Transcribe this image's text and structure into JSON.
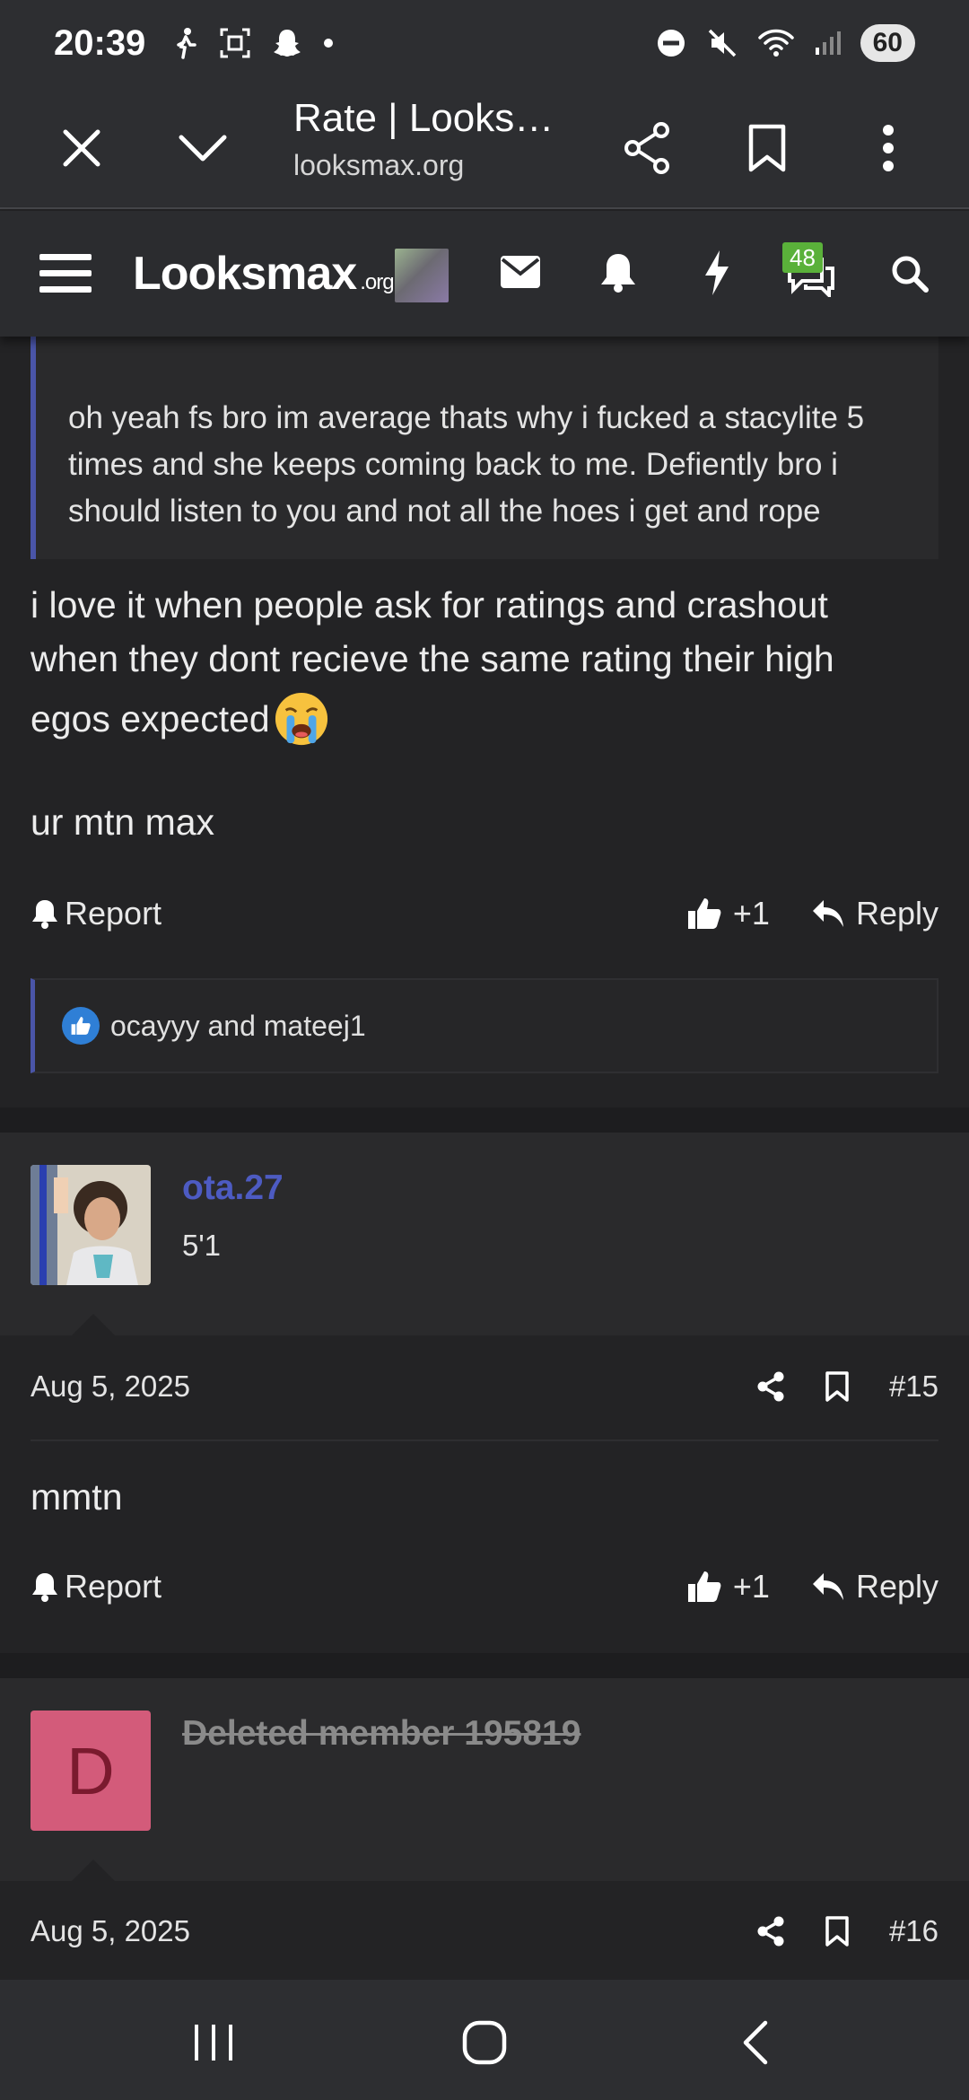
{
  "status_bar": {
    "time": "20:39",
    "battery": "60"
  },
  "browser": {
    "title": "Rate | Looks…",
    "url": "looksmax.org"
  },
  "site_header": {
    "logo": "Looksmax",
    "logo_suffix": ".org",
    "notifications_badge": "48"
  },
  "quote": {
    "text": "oh yeah fs bro im average thats why i fucked a stacylite 5 times and she keeps coming back to me. Defiently bro i should listen to you and not all the hoes i get and rope"
  },
  "post14": {
    "line1": "i love it when people ask for ratings and crashout",
    "line2": "when they dont recieve the same rating their high",
    "line3": "egos expected",
    "line4": "ur mtn max",
    "report_label": "Report",
    "like_label": "+1",
    "reply_label": "Reply",
    "reactions": "ocayyy and mateej1"
  },
  "post15": {
    "username": "ota.27",
    "user_title": "5'1",
    "date": "Aug 5, 2025",
    "number": "#15",
    "body": "mmtn",
    "report_label": "Report",
    "like_label": "+1",
    "reply_label": "Reply"
  },
  "post16": {
    "avatar_letter": "D",
    "username": "Deleted member 195819",
    "date": "Aug 5, 2025",
    "number": "#16"
  },
  "colors": {
    "accent": "#4a55a8",
    "username": "#4d5bc2",
    "badge": "#5ab13a",
    "deleted_avatar": "#d35b7a"
  }
}
